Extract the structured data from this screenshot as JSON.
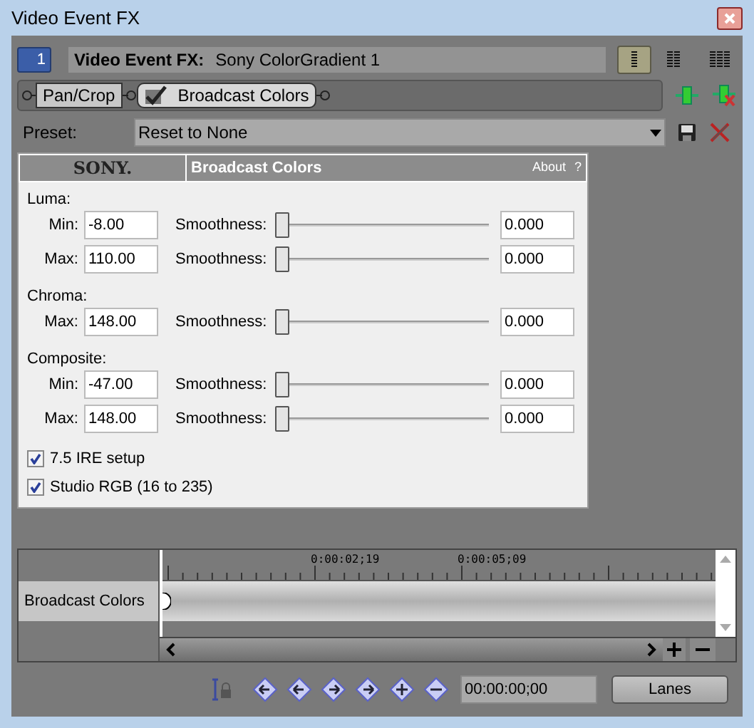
{
  "window": {
    "title": "Video Event FX"
  },
  "header": {
    "badge": "1",
    "label": "Video Event FX:",
    "value": "Sony ColorGradient 1",
    "views": [
      {
        "selected": true
      },
      {
        "selected": false
      },
      {
        "selected": false
      }
    ]
  },
  "chain": [
    {
      "label": "Pan/Crop",
      "kind": "plain",
      "selected": false
    },
    {
      "label": "Broadcast Colors",
      "kind": "check",
      "selected": true,
      "checked": true
    }
  ],
  "preset": {
    "label": "Preset:",
    "value": "Reset to None"
  },
  "plugin": {
    "brand": "SONY.",
    "title": "Broadcast Colors",
    "about": "About",
    "help": "?",
    "groups": [
      {
        "label": "Luma:",
        "rows": [
          {
            "label": "Min:",
            "value": "-8.00",
            "smoothness": "Smoothness:",
            "level": 0,
            "reading": "0.000"
          },
          {
            "label": "Max:",
            "value": "110.00",
            "smoothness": "Smoothness:",
            "level": 0,
            "reading": "0.000"
          }
        ]
      },
      {
        "label": "Chroma:",
        "rows": [
          {
            "label": "Max:",
            "value": "148.00",
            "smoothness": "Smoothness:",
            "level": 0,
            "reading": "0.000"
          }
        ]
      },
      {
        "label": "Composite:",
        "rows": [
          {
            "label": "Min:",
            "value": "-47.00",
            "smoothness": "Smoothness:",
            "level": 0,
            "reading": "0.000"
          },
          {
            "label": "Max:",
            "value": "148.00",
            "smoothness": "Smoothness:",
            "level": 0,
            "reading": "0.000"
          }
        ]
      }
    ],
    "options": [
      {
        "label": "7.5 IRE setup",
        "checked": true
      },
      {
        "label": "Studio RGB (16 to 235)",
        "checked": true
      }
    ]
  },
  "timeline": {
    "ticks": [
      "0:00:02;19",
      "0:00:05;09"
    ],
    "track": "Broadcast Colors",
    "time": "00:00:00;00",
    "button": "Lanes"
  }
}
